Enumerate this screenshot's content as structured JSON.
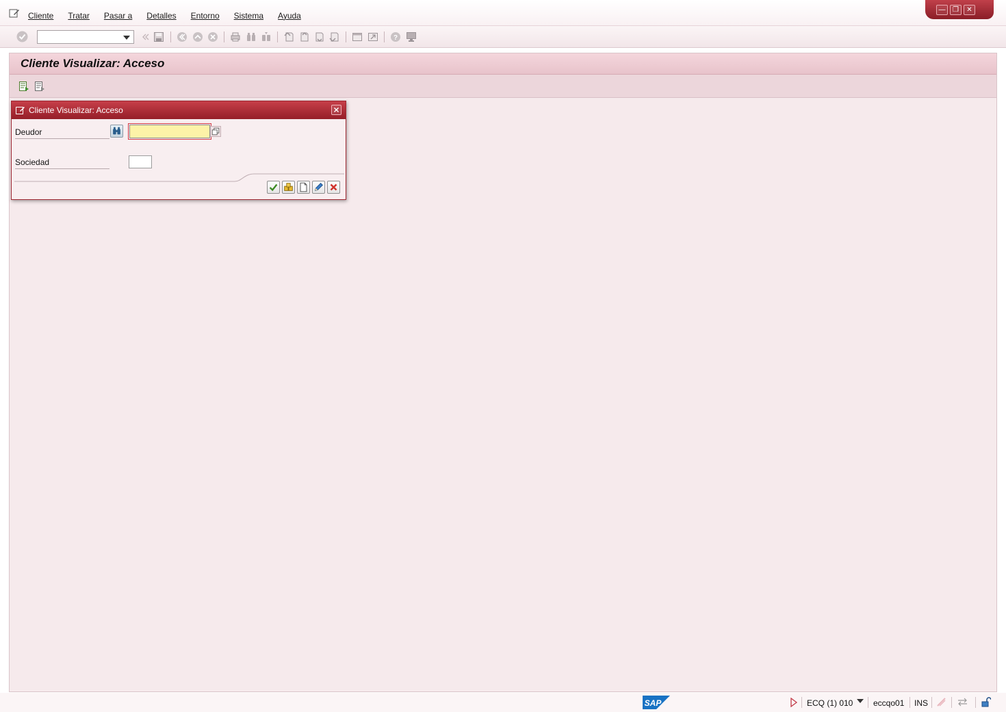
{
  "menu": {
    "items": [
      "Cliente",
      "Tratar",
      "Pasar a",
      "Detalles",
      "Entorno",
      "Sistema",
      "Ayuda"
    ]
  },
  "toolbar": {
    "command_field": {
      "value": "",
      "placeholder": ""
    }
  },
  "page": {
    "title": "Cliente Visualizar: Acceso"
  },
  "dialog": {
    "title": "Cliente Visualizar: Acceso",
    "fields": {
      "deudor": {
        "label": "Deudor",
        "value": ""
      },
      "sociedad": {
        "label": "Sociedad",
        "value": ""
      }
    },
    "buttons": [
      "confirm-icon",
      "all-data-icon",
      "new-document-icon",
      "edit-pencil-icon",
      "cancel-icon"
    ]
  },
  "status": {
    "system": "ECQ (1) 010",
    "user": "eccqo01",
    "mode": "INS"
  },
  "colors": {
    "accent_red": "#951e28",
    "work_bg": "#f6eaec",
    "required_field": "#fdf2a8"
  }
}
